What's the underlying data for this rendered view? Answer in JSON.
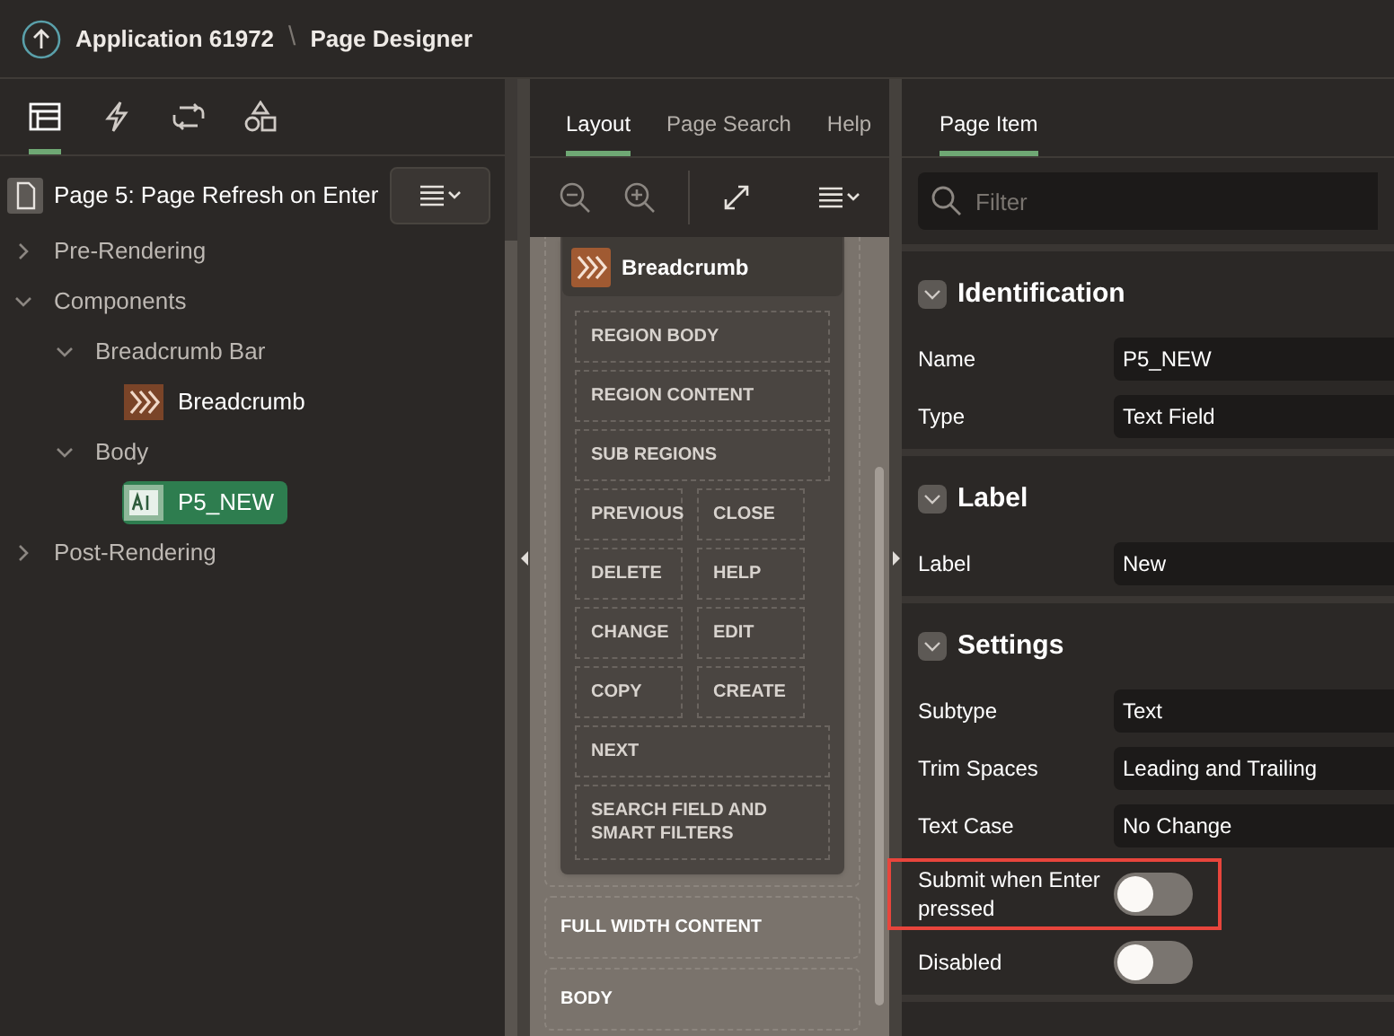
{
  "header": {
    "app": "Application 61972",
    "separator": "\\",
    "page": "Page Designer"
  },
  "left_tabs": [
    {
      "selected": true
    },
    {
      "selected": false
    },
    {
      "selected": false
    },
    {
      "selected": false
    }
  ],
  "page_title": "Page 5: Page Refresh on Enter",
  "tree": [
    {
      "label": "Pre-Rendering",
      "kind": "group",
      "expanded": false
    },
    {
      "label": "Components",
      "kind": "group",
      "expanded": true,
      "children": [
        {
          "label": "Breadcrumb Bar",
          "kind": "group",
          "expanded": true,
          "children": [
            {
              "label": "Breadcrumb",
              "kind": "region",
              "selected": false
            }
          ]
        },
        {
          "label": "Body",
          "kind": "group",
          "expanded": true,
          "children": [
            {
              "label": "P5_NEW",
              "kind": "item",
              "selected": true
            }
          ]
        }
      ]
    },
    {
      "label": "Post-Rendering",
      "kind": "group",
      "expanded": false
    }
  ],
  "middle_tabs": [
    {
      "label": "Layout",
      "selected": true
    },
    {
      "label": "Page Search",
      "selected": false
    },
    {
      "label": "Help",
      "selected": false
    }
  ],
  "canvas": {
    "region": "Breadcrumb",
    "slot_rows": [
      [
        "REGION BODY"
      ],
      [
        "REGION CONTENT"
      ],
      [
        "SUB REGIONS"
      ],
      [
        "PREVIOUS",
        "CLOSE"
      ],
      [
        "DELETE",
        "HELP"
      ],
      [
        "CHANGE",
        "EDIT"
      ],
      [
        "COPY",
        "CREATE"
      ],
      [
        "NEXT"
      ],
      [
        "SEARCH FIELD AND SMART FILTERS"
      ]
    ],
    "page_slots": [
      "FULL WIDTH CONTENT",
      "BODY"
    ]
  },
  "right_tab": {
    "label": "Page Item",
    "selected": true
  },
  "filter": {
    "placeholder": "Filter"
  },
  "sections": [
    {
      "title": "Identification",
      "expanded": true,
      "properties": [
        {
          "label": "Name",
          "kind": "text",
          "value": "P5_NEW"
        },
        {
          "label": "Type",
          "kind": "text",
          "value": "Text Field"
        }
      ]
    },
    {
      "title": "Label",
      "expanded": true,
      "properties": [
        {
          "label": "Label",
          "kind": "text",
          "value": "New"
        }
      ]
    },
    {
      "title": "Settings",
      "expanded": true,
      "properties": [
        {
          "label": "Subtype",
          "kind": "text",
          "value": "Text"
        },
        {
          "label": "Trim Spaces",
          "kind": "text",
          "value": "Leading and Trailing"
        },
        {
          "label": "Text Case",
          "kind": "text",
          "value": "No Change"
        },
        {
          "label": "Submit when Enter pressed",
          "kind": "switch",
          "on": false,
          "highlighted": true
        },
        {
          "label": "Disabled",
          "kind": "switch",
          "on": false,
          "highlighted": false
        }
      ]
    }
  ]
}
